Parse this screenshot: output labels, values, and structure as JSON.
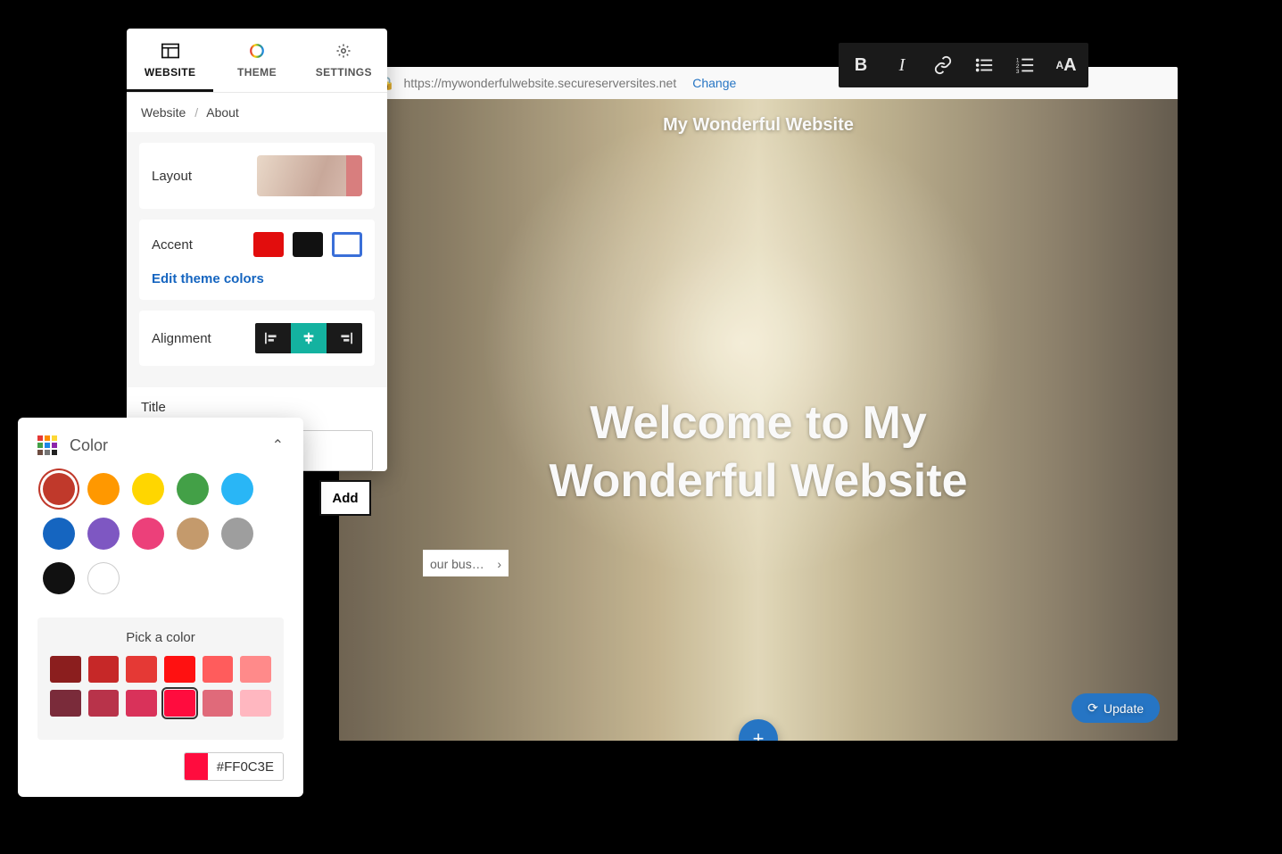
{
  "toolbar": {
    "items": [
      "bold",
      "italic",
      "link",
      "bullet-list",
      "numbered-list",
      "text-size"
    ]
  },
  "preview": {
    "url": "https://mywonderfulwebsite.secureserversites.net",
    "change_label": "Change",
    "site_name": "My Wonderful Website",
    "hero_line1": "Welcome to My",
    "hero_line2": "Wonderful Website",
    "update_label": "Update"
  },
  "sidebar": {
    "tabs": [
      {
        "id": "website",
        "label": "WEBSITE"
      },
      {
        "id": "theme",
        "label": "THEME"
      },
      {
        "id": "settings",
        "label": "SETTINGS"
      }
    ],
    "breadcrumb": {
      "root": "Website",
      "page": "About"
    },
    "layout_label": "Layout",
    "accent_label": "Accent",
    "accent_swatches": [
      "#e20d0d",
      "#111111",
      "#ffffff"
    ],
    "edit_colors_label": "Edit theme colors",
    "alignment_label": "Alignment",
    "title_label": "Title",
    "add_label": "Add",
    "tagline_placeholder": "our bus…"
  },
  "color_picker": {
    "title": "Color",
    "palette": [
      "#c0392b",
      "#f39c12",
      "#f1c40f",
      "#27ae60",
      "#1abc9c",
      "#2980b9",
      "#8e44ad",
      "#e91e63",
      "#b8860b",
      "#7f8c8d",
      "#111111",
      "#ffffff"
    ],
    "palette_adjusted": [
      "#c0392b",
      "#ff9800",
      "#ffd600",
      "#43a047",
      "#29b6f6",
      "#1565c0",
      "#7e57c2",
      "#ec407a",
      "#c49a6c",
      "#9e9e9e",
      "#111111",
      "#ffffff"
    ],
    "selected_palette_index": 0,
    "shades_label": "Pick a color",
    "shades": [
      "#8b1e1e",
      "#c62828",
      "#e53935",
      "#ff1111",
      "#ff5c5c",
      "#ff8a8a",
      "#7a2b3a",
      "#b8334a",
      "#d9325a",
      "#ff0c3e",
      "#e06a7a",
      "#ffb7c0"
    ],
    "selected_shade_index": 9,
    "hex": "#FF0C3E"
  }
}
